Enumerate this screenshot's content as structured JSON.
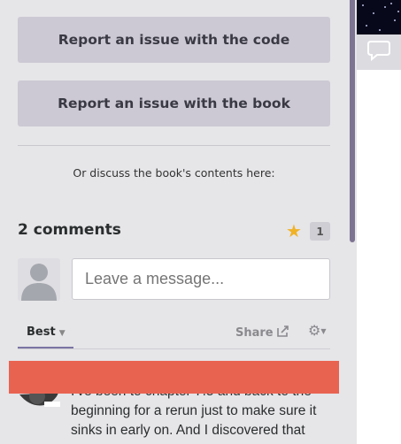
{
  "buttons": {
    "report_code": "Report an issue with the code",
    "report_book": "Report an issue with the book"
  },
  "discuss_text": "Or discuss the book's contents here:",
  "comments": {
    "title": "2 comments",
    "star_count": "1",
    "input_placeholder": "Leave a message...",
    "sort_label": "Best",
    "share_label": "Share",
    "first_comment_lines": [
      "I've been to chapter 7.5 and back to the",
      "beginning for a rerun just to make sure it",
      "sinks in early on. And I discovered that"
    ]
  },
  "icons": {
    "sidebar_comment": "speech-bubble-icon",
    "star": "star-icon",
    "share": "share-icon",
    "settings": "gear-icon",
    "avatar": "user-avatar-icon"
  },
  "colors": {
    "accent": "#7b74a4",
    "scrollbar": "#7d7492",
    "alert_bar": "#e96351",
    "star": "#f0b226"
  }
}
